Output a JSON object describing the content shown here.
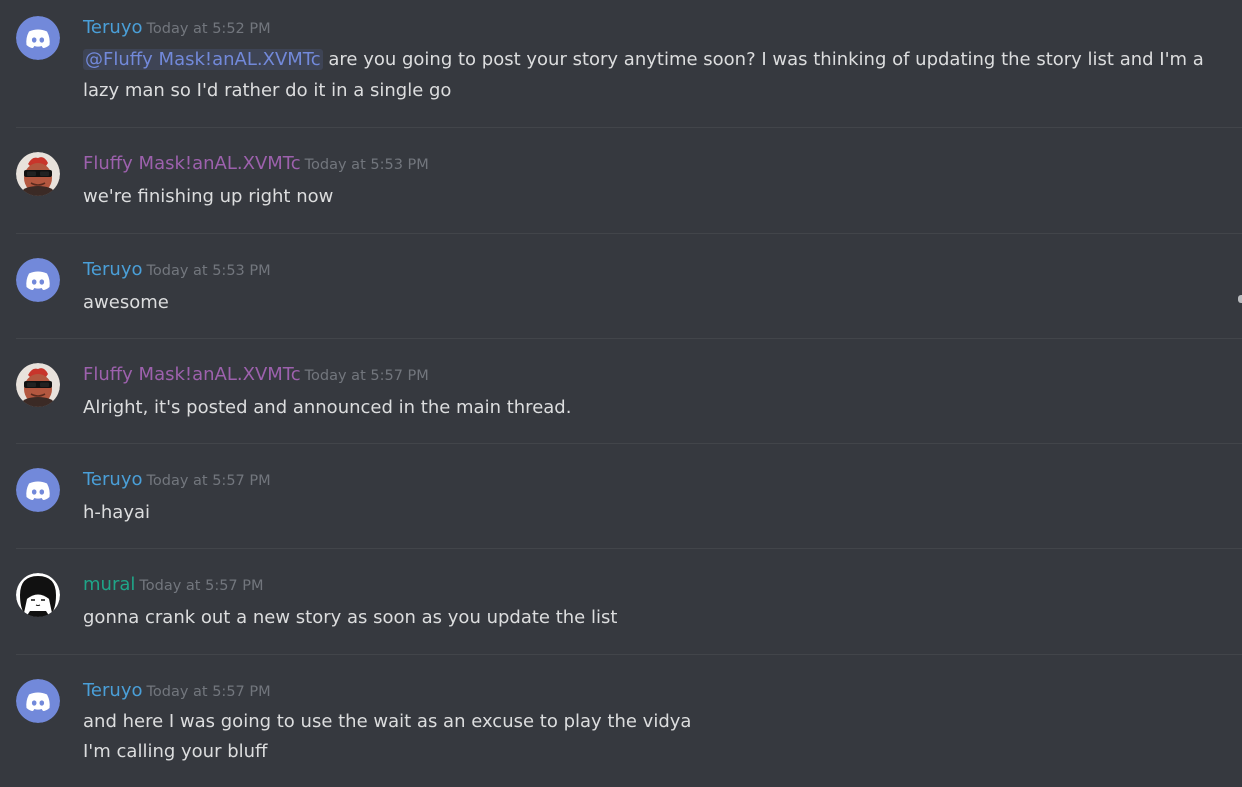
{
  "colors": {
    "background": "#36393f",
    "teruyo": "#4a9fd8",
    "fluffy": "#9d61ad",
    "mural": "#1fa588",
    "timestamp": "#72767d",
    "mention": "#7289da",
    "discord_blurple": "#7289da"
  },
  "messages": [
    {
      "author": "Teruyo",
      "avatar_icon": "discord-default-avatar-icon",
      "timestamp": "Today at 5:52 PM",
      "mention": "@Fluffy Mask!anAL.XVMTc",
      "text": " are you going to post your story anytime soon? I was thinking of updating the story list and I'm a lazy man so I'd rather do it in a single go"
    },
    {
      "author": "Fluffy Mask!anAL.XVMTc",
      "avatar_icon": "sunglasses-face-avatar-icon",
      "timestamp": "Today at 5:53 PM",
      "text": "we're finishing up right now"
    },
    {
      "author": "Teruyo",
      "avatar_icon": "discord-default-avatar-icon",
      "timestamp": "Today at 5:53 PM",
      "text": "awesome"
    },
    {
      "author": "Fluffy Mask!anAL.XVMTc",
      "avatar_icon": "sunglasses-face-avatar-icon",
      "timestamp": "Today at 5:57 PM",
      "text": "Alright, it's posted and announced in the main thread."
    },
    {
      "author": "Teruyo",
      "avatar_icon": "discord-default-avatar-icon",
      "timestamp": "Today at 5:57 PM",
      "text": "h-hayai"
    },
    {
      "author": "mural",
      "avatar_icon": "anime-girl-avatar-icon",
      "timestamp": "Today at 5:57 PM",
      "text": "gonna crank out a new story as soon as you update the list"
    },
    {
      "author": "Teruyo",
      "avatar_icon": "discord-default-avatar-icon",
      "timestamp": "Today at 5:57 PM",
      "text": "and here I was going to use the wait as an excuse to play the vidya",
      "text2": "I'm calling your bluff"
    }
  ]
}
